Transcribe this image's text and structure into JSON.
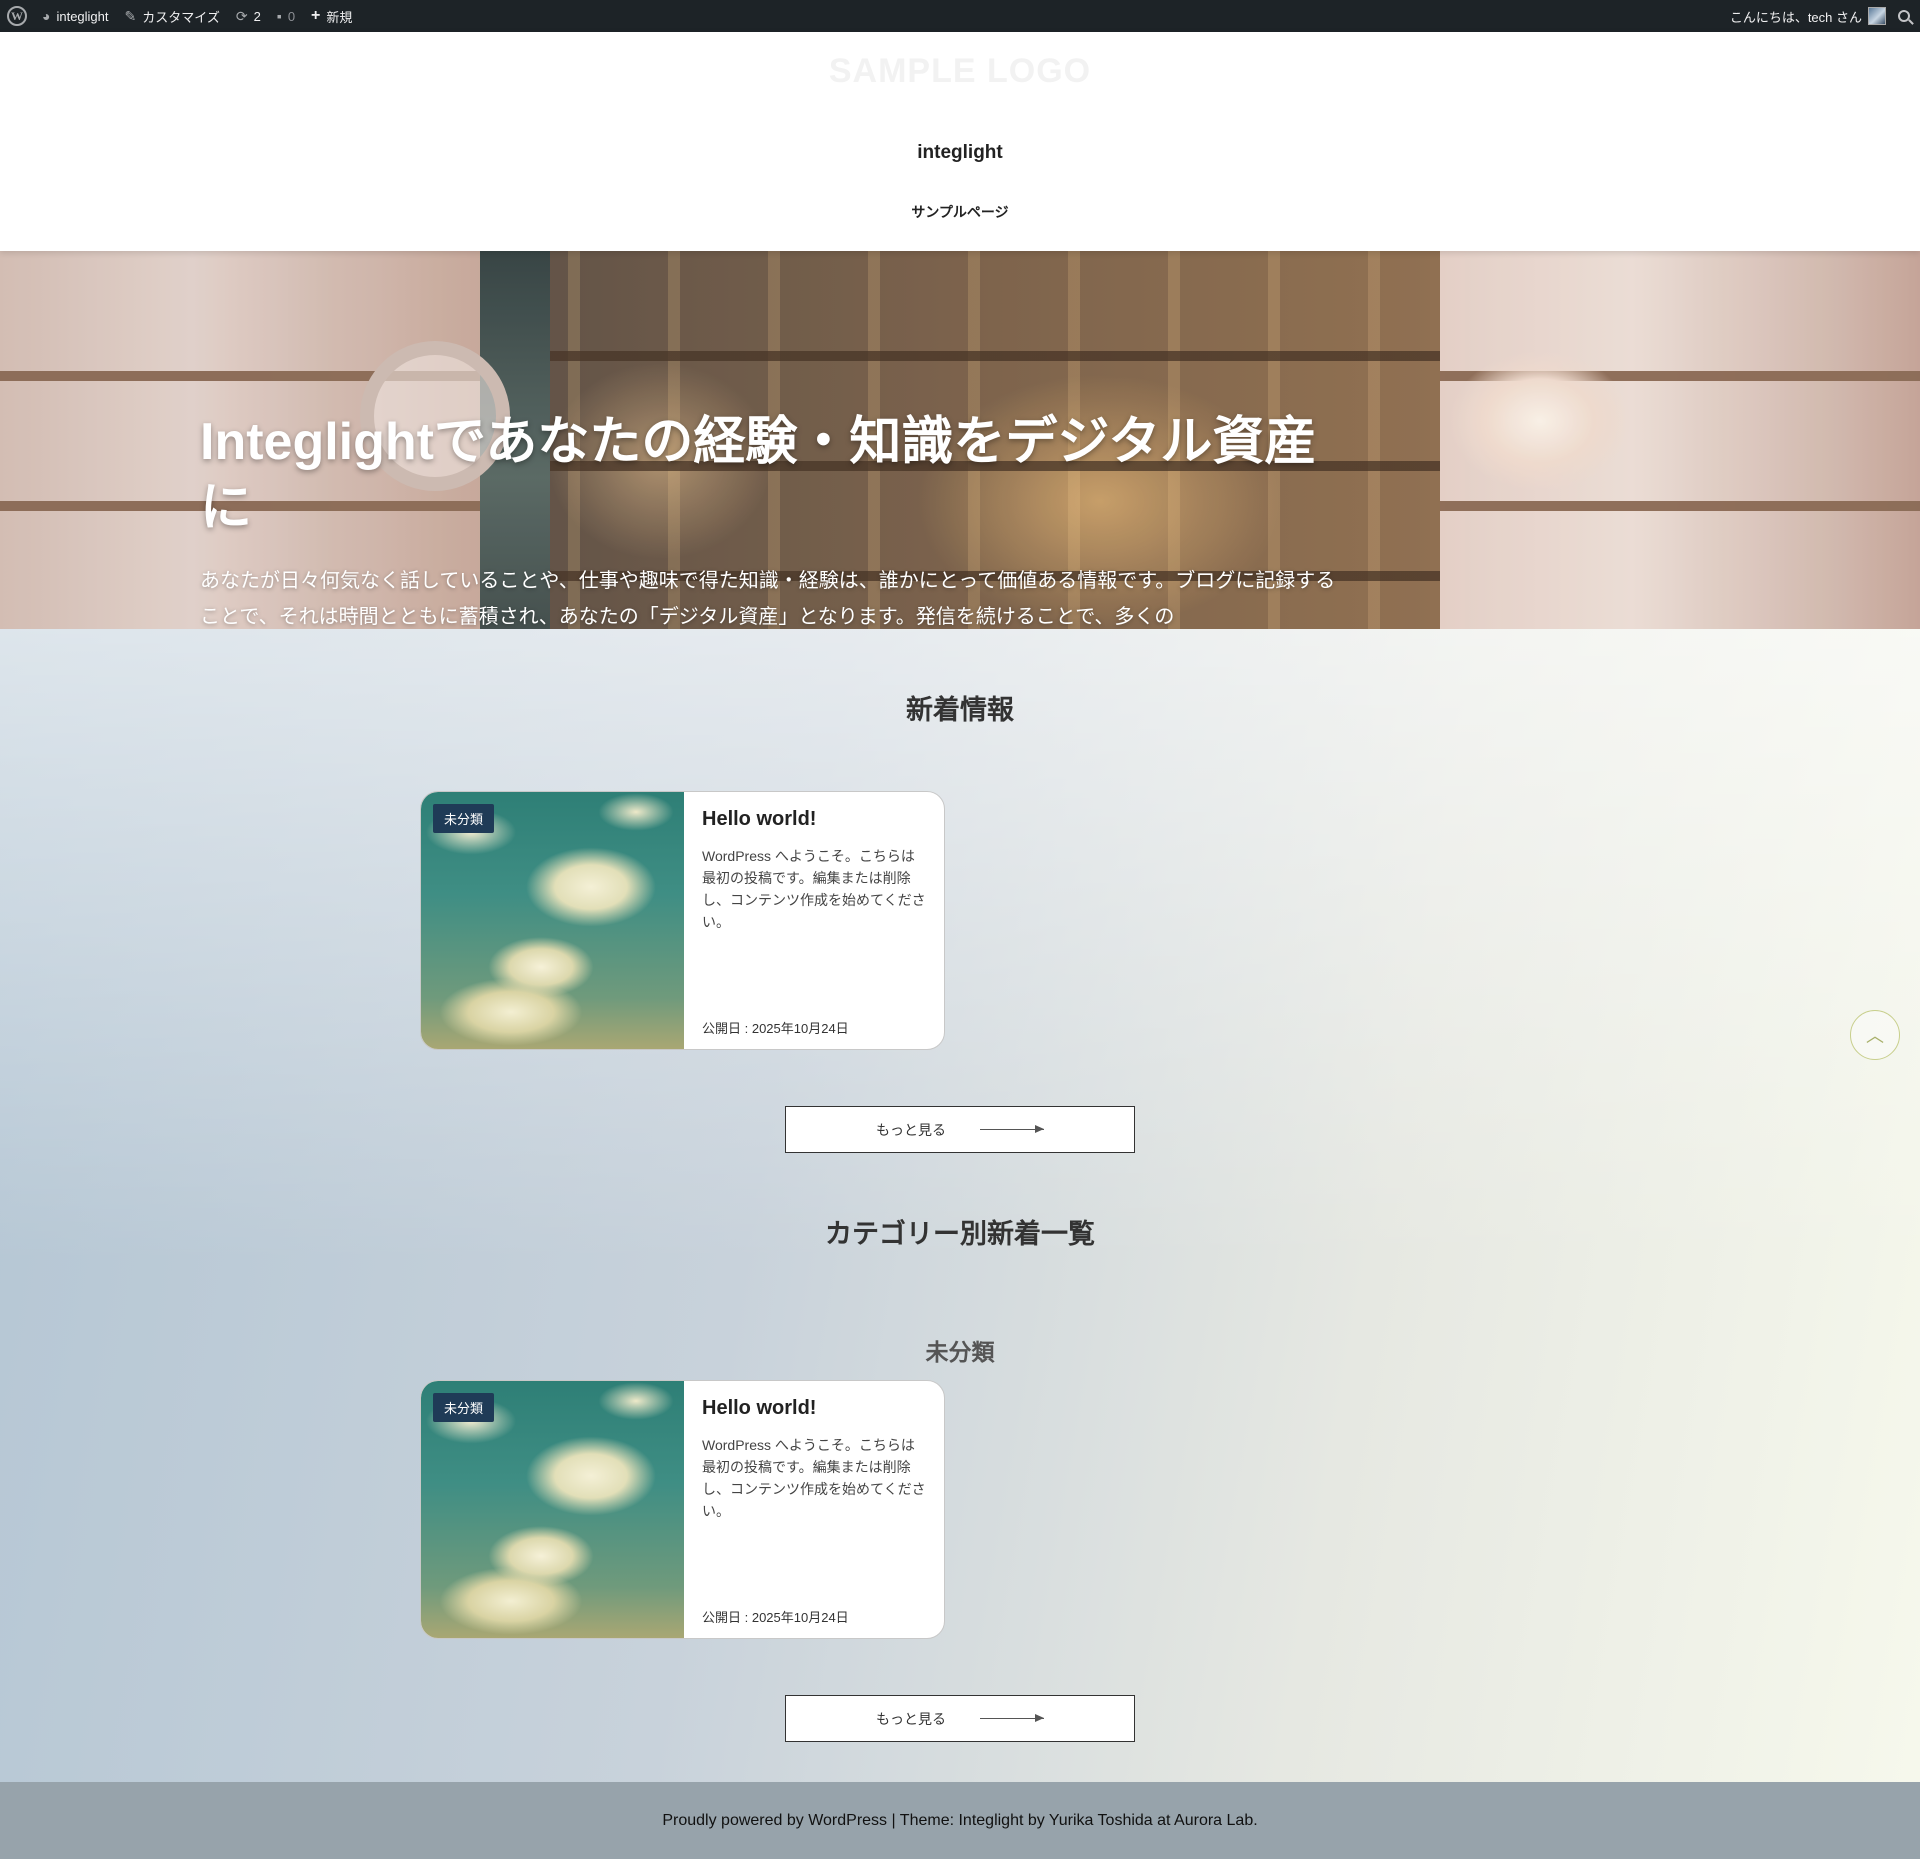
{
  "admin_bar": {
    "site_name": "integlight",
    "customize_label": "カスタマイズ",
    "updates_count": "2",
    "comments_count": "0",
    "new_label": "新規",
    "greeting": "こんにちは、tech さん"
  },
  "header": {
    "logo_text": "SAMPLE LOGO",
    "site_title": "integlight",
    "nav": [
      "サンプルページ"
    ]
  },
  "hero": {
    "title": "Integlightであなたの経験・知識をデジタル資産に",
    "text": "あなたが日々何気なく話していることや、仕事や趣味で得た知識・経験は、誰かにとって価値ある情報です。ブログに記録することで、それは時間とともに蓄積され、あなたの「デジタル資産」となります。発信を続けることで、多くの"
  },
  "sections": {
    "new_posts_title": "新着情報",
    "category_posts_title": "カテゴリー別新着一覧",
    "category_name": "未分類"
  },
  "posts": [
    {
      "badge": "未分類",
      "title": "Hello world!",
      "excerpt": "WordPress へようこそ。こちらは最初の投稿です。編集または削除し、コンテンツ作成を始めてください。",
      "date": "公開日 : 2025年10月24日"
    },
    {
      "badge": "未分類",
      "title": "Hello world!",
      "excerpt": "WordPress へようこそ。こちらは最初の投稿です。編集または削除し、コンテンツ作成を始めてください。",
      "date": "公開日 : 2025年10月24日"
    }
  ],
  "more_button_label": "もっと見る",
  "to_top_symbol": "︿",
  "footer": {
    "text": "Proudly powered by WordPress | Theme: Integlight by Yurika Toshida at Aurora Lab."
  },
  "colors": {
    "admin_bar_bg": "#1d2327",
    "badge_bg": "#1f3b57",
    "footer_bg": "#97a3ab"
  },
  "icons": [
    "wordpress-logo-icon",
    "dashboard-icon",
    "brush-icon",
    "updates-icon",
    "comment-icon",
    "plus-icon",
    "avatar-icon",
    "search-icon",
    "arrow-right-icon",
    "chevron-up-icon"
  ]
}
